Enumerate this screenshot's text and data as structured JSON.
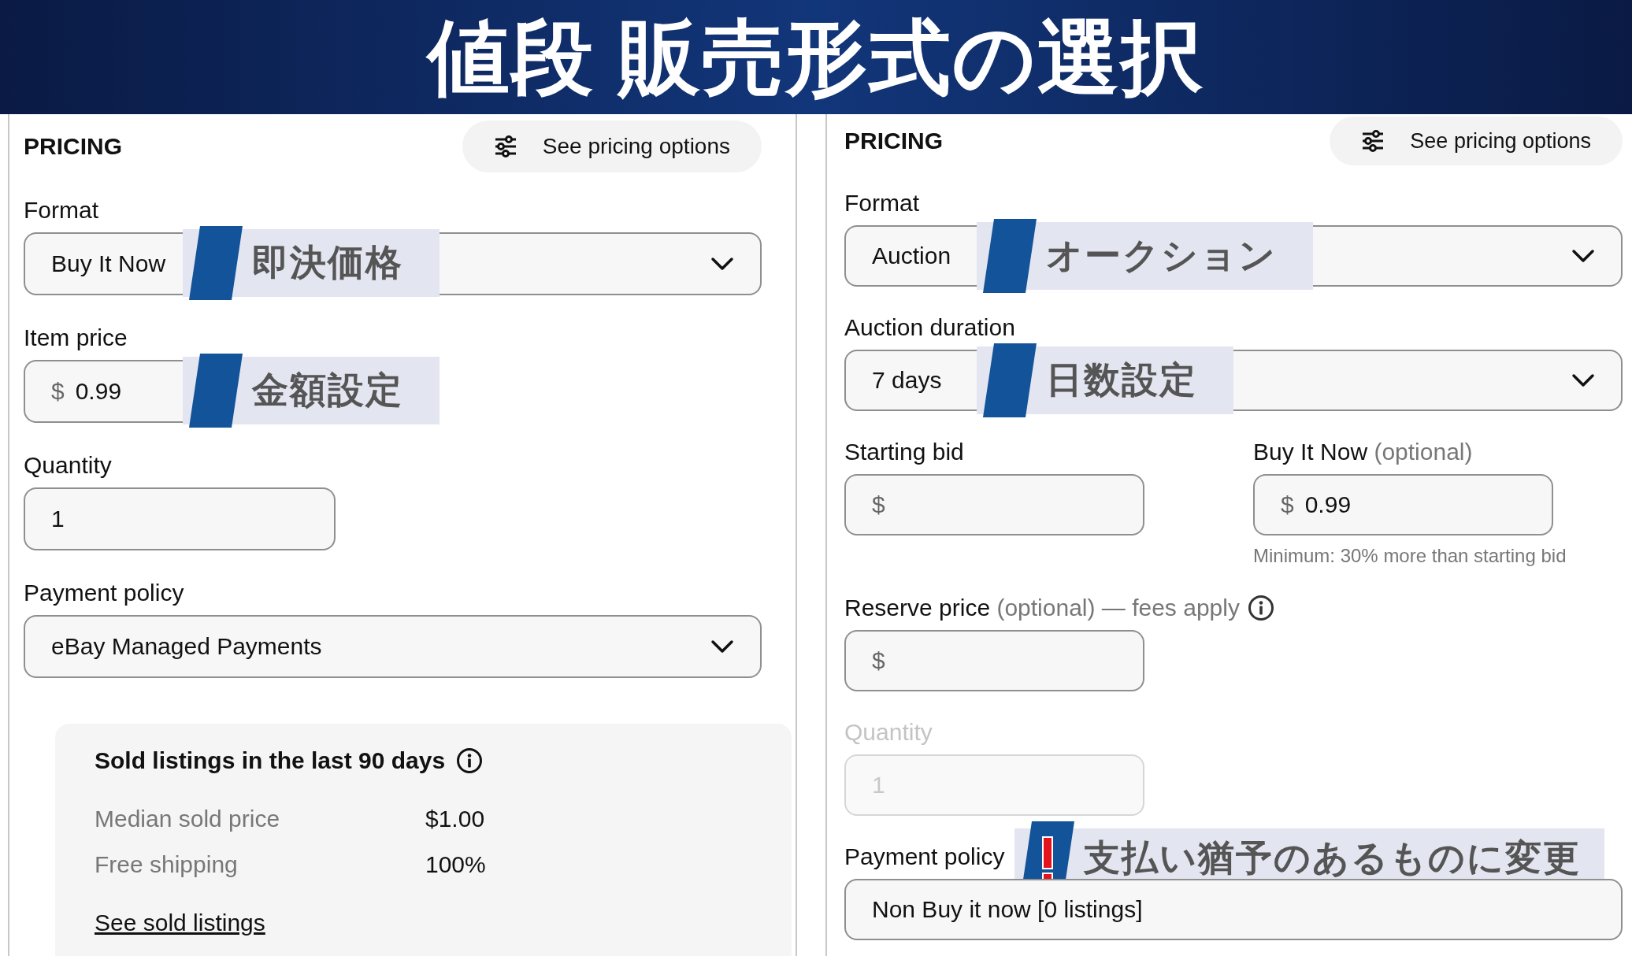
{
  "banner": {
    "title": "値段 販売形式の選択"
  },
  "left_panel": {
    "heading": "PRICING",
    "options_button": "See pricing options",
    "fields": [
      {
        "kind": "select",
        "label": "Format",
        "value": "Buy It Now",
        "disabled": false,
        "annotation": {
          "kind": "tag",
          "text": "即決価格"
        }
      },
      {
        "kind": "price",
        "label": "Item price",
        "prefix": "$",
        "value": "0.99",
        "disabled": false,
        "annotation": {
          "kind": "tag",
          "text": "金額設定"
        }
      },
      {
        "kind": "text",
        "label": "Quantity",
        "value": "1",
        "disabled": false
      },
      {
        "kind": "select",
        "label": "Payment policy",
        "value": "eBay Managed Payments",
        "disabled": false
      }
    ],
    "sold_listings": {
      "title": "Sold listings in the last 90 days",
      "rows": [
        {
          "label": "Median sold price",
          "value": "$1.00"
        },
        {
          "label": "Free shipping",
          "value": "100%"
        }
      ],
      "link": "See sold listings"
    }
  },
  "right_panel": {
    "heading": "PRICING",
    "options_button": "See pricing options",
    "fields": [
      {
        "kind": "select",
        "label": "Format",
        "value": "Auction",
        "disabled": false,
        "annotation": {
          "kind": "tag",
          "text": "オークション"
        }
      },
      {
        "kind": "select",
        "label": "Auction duration",
        "value": "7 days",
        "disabled": false,
        "annotation": {
          "kind": "tag",
          "text": "日数設定"
        }
      },
      {
        "kind": "pair",
        "items": [
          {
            "kind": "price",
            "label": "Starting bid",
            "prefix": "$",
            "disabled": false
          },
          {
            "kind": "price",
            "label": "Buy It Now",
            "note": "(optional)",
            "prefix": "$",
            "value": "0.99",
            "disabled": false,
            "hint": "Minimum: 30% more than starting bid"
          }
        ]
      },
      {
        "kind": "price",
        "label": "Reserve price",
        "note": "(optional) — fees apply",
        "info": true,
        "prefix": "$",
        "disabled": false
      },
      {
        "kind": "text",
        "label": "Quantity",
        "value": "1",
        "disabled": true
      },
      {
        "kind": "select",
        "label": "Payment policy",
        "value": "Non Buy it now [0 listings]",
        "disabled": false,
        "chevron": false,
        "annotation": {
          "kind": "warning",
          "text": "支払い猶予のあるものに変更"
        }
      }
    ]
  }
}
